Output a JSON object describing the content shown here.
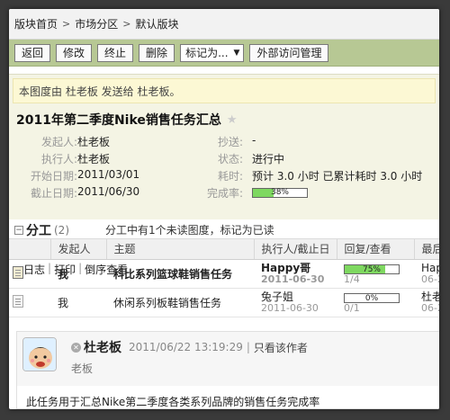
{
  "breadcrumb": [
    "版块首页",
    "市场分区",
    "默认版块"
  ],
  "toolbar": {
    "back": "返回",
    "edit": "修改",
    "stop": "终止",
    "delete": "删除",
    "mark_as": "标记为...",
    "external": "外部访问管理"
  },
  "notice": "本图度由 杜老板 发送给 杜老板。",
  "task": {
    "title": "2011年第二季度Nike销售任务汇总",
    "fields": {
      "sender_label": "发起人:",
      "sender": "杜老板",
      "cc_label": "抄送:",
      "cc": "-",
      "executor_label": "执行人:",
      "executor": "杜老板",
      "status_label": "状态:",
      "status": "进行中",
      "start_label": "开始日期:",
      "start": "2011/03/01",
      "time_label": "耗时:",
      "time": "预计 3.0 小时  已累计耗时 3.0 小时",
      "due_label": "截止日期:",
      "due": "2011/06/30",
      "done_label": "完成率:",
      "done": "38%",
      "done_value": 38
    },
    "links": [
      "日志",
      "打印",
      "倒序查看"
    ]
  },
  "subtasks": {
    "title": "分工",
    "count": "(2)",
    "message": "分工中有1个未读图度，标记为已读",
    "columns": [
      "发起人",
      "主题",
      "执行人/截止日",
      "回复/查看",
      "最后"
    ],
    "rows": [
      {
        "sender": "我",
        "subject": "科比系列篮球鞋销售任务",
        "executor": "Happy哥",
        "date": "2011-06-30",
        "progress": "75%",
        "progress_value": 75,
        "replies": "1/4",
        "last": "Hap",
        "last2": "06-2",
        "bold": true
      },
      {
        "sender": "我",
        "subject": "休闲系列板鞋销售任务",
        "executor": "兔子姐",
        "date": "2011-06-30",
        "progress": "0%",
        "progress_value": 0,
        "replies": "0/1",
        "last": "杜老",
        "last2": "06-2",
        "bold": false
      }
    ]
  },
  "comment": {
    "author": "杜老板",
    "date": "2011/06/22 13:19:29",
    "only_author": "只看该作者",
    "role": "老板",
    "body": "此任务用于汇总Nike第二季度各类系列品牌的销售任务完成率"
  },
  "colors": {
    "toolbar": "#b7c894",
    "progress": "#7ed860",
    "panel": "#f4f4e4"
  }
}
